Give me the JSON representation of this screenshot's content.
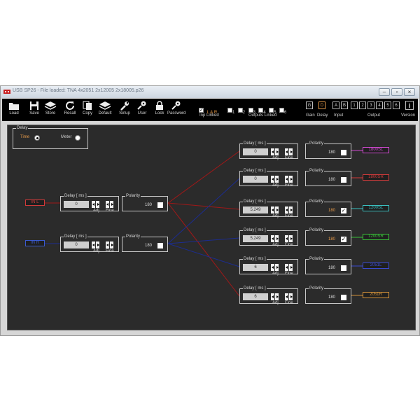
{
  "window": {
    "title": "USB SP26 - File loaded: TNA 4x2051 2x12005 2x18005.p26"
  },
  "toolbar": {
    "buttons": [
      {
        "label": "Load",
        "icon": "folder-icon"
      },
      {
        "label": "Save",
        "icon": "disk-icon"
      },
      {
        "label": "Store",
        "icon": "chip-icon"
      },
      {
        "label": "Recall",
        "icon": "refresh-icon"
      },
      {
        "label": "Copy",
        "icon": "copy-icon"
      },
      {
        "label": "Default",
        "icon": "chip-icon"
      },
      {
        "label": "Setup",
        "icon": "wrench-icon"
      },
      {
        "label": "User",
        "icon": "key-icon"
      },
      {
        "label": "Lock",
        "icon": "lock-icon"
      },
      {
        "label": "Password",
        "icon": "key-icon"
      }
    ],
    "inp_linked_label": "Inp Linked",
    "lr_label": "L & R",
    "outputs_linked_label": "Outputs Linked",
    "output_link_numbers": [
      "1",
      "2",
      "3",
      "4",
      "5",
      "6"
    ],
    "gain_label": "Gain",
    "delay_label": "Delay",
    "input_label": "Input",
    "output_label": "Output",
    "version_label": "Version",
    "gain_key": "G",
    "delay_key": "D",
    "input_keys": [
      "A",
      "B"
    ],
    "output_keys": [
      "1",
      "2",
      "3",
      "4",
      "5",
      "6"
    ],
    "version_key": "i"
  },
  "delay_mode": {
    "caption": "Delay",
    "time_label": "Time",
    "meter_label": "Meter",
    "selected": "Time"
  },
  "inputs": [
    {
      "tag": "IN L",
      "color": "#d03a3a",
      "delay_caption": "Delay [ ms ]",
      "value": "0",
      "adj": "Adj",
      "fine": "Fine",
      "polarity_caption": "Polarity",
      "polarity": "180",
      "checked": false
    },
    {
      "tag": "IN R",
      "color": "#3a5ad0",
      "delay_caption": "Delay [ ms ]",
      "value": "0",
      "adj": "Adj",
      "fine": "Fine",
      "polarity_caption": "Polarity",
      "polarity": "180",
      "checked": false
    }
  ],
  "outputs": [
    {
      "tag": "1800SL",
      "color": "#d04ad0",
      "delay_caption": "Delay [ ms ]",
      "value": "0",
      "adj": "Adj",
      "fine": "Fine",
      "polarity_caption": "Polarity",
      "polarity": "180",
      "checked": false,
      "highlight": false
    },
    {
      "tag": "1800SR",
      "color": "#d03a3a",
      "delay_caption": "Delay [ ms ]",
      "value": "0",
      "adj": "Adj",
      "fine": "Fine",
      "polarity_caption": "Polarity",
      "polarity": "180",
      "checked": false,
      "highlight": false
    },
    {
      "tag": "1200SL",
      "color": "#3ac0c0",
      "delay_caption": "Delay [ ms ]",
      "value": "5,249",
      "adj": "Adj",
      "fine": "Fine",
      "polarity_caption": "Polarity",
      "polarity": "180",
      "checked": true,
      "highlight": true
    },
    {
      "tag": "1200SR",
      "color": "#3ac03a",
      "delay_caption": "Delay [ ms ]",
      "value": "5,249",
      "adj": "Adj",
      "fine": "Fine",
      "polarity_caption": "Polarity",
      "polarity": "180",
      "checked": true,
      "highlight": true
    },
    {
      "tag": "2051L",
      "color": "#3a4ad0",
      "delay_caption": "Delay [ ms ]",
      "value": "6",
      "adj": "Adj",
      "fine": "Fine",
      "polarity_caption": "Polarity",
      "polarity": "180",
      "checked": false,
      "highlight": false
    },
    {
      "tag": "2051R",
      "color": "#d0903a",
      "delay_caption": "Delay [ ms ]",
      "value": "6",
      "adj": "Adj",
      "fine": "Fine",
      "polarity_caption": "Polarity",
      "polarity": "180",
      "checked": false,
      "highlight": false
    }
  ],
  "colors": {
    "link_left": "#a01818",
    "link_right": "#1c2c90"
  }
}
